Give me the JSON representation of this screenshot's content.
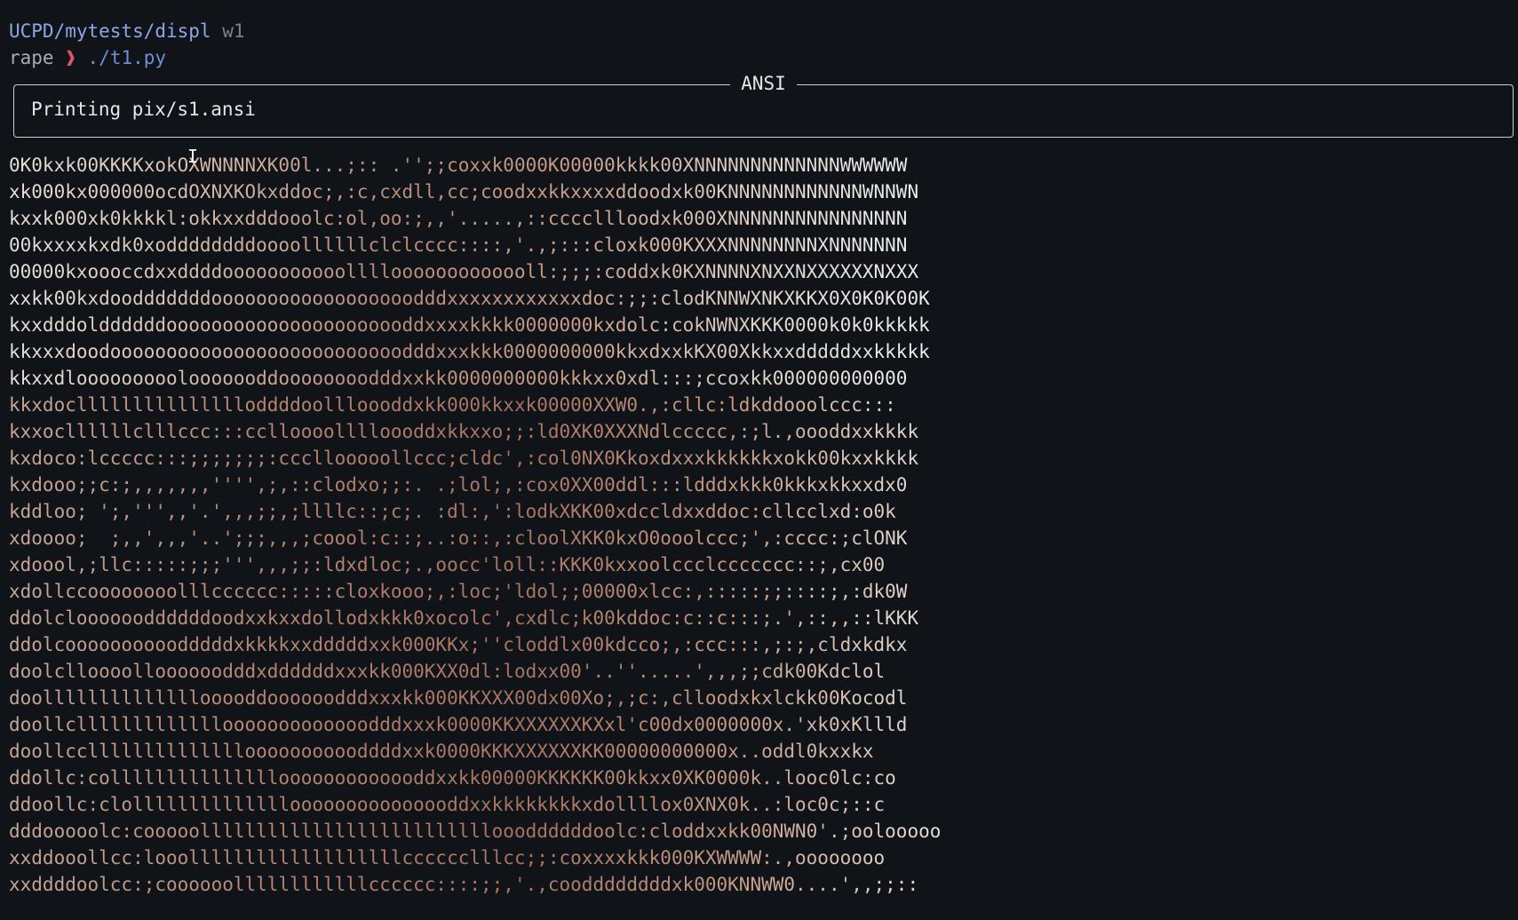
{
  "terminal": {
    "prompt": {
      "path": "UCPD/mytests/displ",
      "host": "w1",
      "cwd_tail": "rape",
      "arrow": "❱",
      "command": "./t1.py"
    },
    "panel": {
      "title": "ANSI",
      "message": "Printing pix/s1.ansi"
    },
    "art_lines": [
      "0K0kxk00KKKKxokOXWNNNNXK00l...;:: .'';;coxxk0000K00000kkkk00XNNNNNNNNNNNNNWWWWWW",
      "xk000kx000000ocdOXNXKOkxddoc;,:c,cxdll,cc;coodxxkkxxxxddoodxk00KNNNNNNNNNNNNWNNWN",
      "kxxk000xk0kkkkl:okkxxdddooolc:ol,oo:;,,'.....,::ccccllloodxk000XNNNNNNNNNNNNNNNN",
      "00kxxxxkxdk0xoddddddddoooollllllclclcccc::::,'.,;:::cloxk000KXXXNNNNNNNNXNNNNNNN",
      "00000kxoooccdxxddddooooooooooollllooooooooooooll:;;;:coddxk0KXNNNNXNXXNXXXXXXNXXX",
      "xxkk00kxdoodddddddoooooooooooooooooodddxxxxxxxxxxxxdoc:;;:clodKNNWXNKXKKX0X0K0K00K",
      "kxxdddolddddddoooooooooooooooooooooddxxxxkkkk0000000kxdolc:cokNWNXKKK0000k0k0kkkkk",
      "kkxxxdoodoooooooooooooooooooooooooodddxxxkkk0000000000kkxdxxkKX00Xkkxxdddddxxkkkkk",
      "kkxxdlooooooooolooooooddoooooooodddxxkk0000000000kkkxx0xdl:::;ccoxkk000000000000",
      "kkxdocllllllllllllllloddddoollloooddxkk000kkxxk00000XXW0.,:cllc:ldkddooolccc:::",
      "kxxocllllllclllccc:::cclloooolllloooddxkkxxo;;:ld0XK0XXXNdlccccc,:;l.,oooddxxkkkk",
      "kxdoco:lccccc:::;;;;;;;:cccllooooollccc;cldc',:col0NX0Kkoxdxxxkkkkkkxokk00kxxkkkk",
      "kxdooo;;c:;,,,,,,,'''',;,::clodxo;;:. .;lol;,:cox0XX00ddl:::ldddxkkk0kkkxkkxxdx0",
      "kddloo; ';,''',,'.',,,;;,;llllc::;c;. :dl:,':lodkXKK00xdccldxxddoc:cllcclxd:o0k",
      "xdoooo;  ;,,',,,'..';;;,,,;coool:c::;..:o::,:cloolXKK0kxO0ooolccc;',:cccc:;clONK",
      "xdoool,;llc:::::;;;''',,,;;:ldxdloc;.,oocc'loll::KKK0kxxoolccclccccccc::;,cx00",
      "xdollccoooooooolllcccccc:::::cloxkooo;,:loc;'ldol;;00000xlcc:,:::::;;::::;,:dk0W",
      "ddolclooooooddddddoodxxkxxdollodxkkk0xocolc',cxdlc;k00kddoc:c::c:::;.',::,,::lKKK",
      "ddolcoooooooooodddddxkkkkxxdddddxxk000KKx;''cloddlx00kdcco;,:ccc:::,;:;,cldxkdkx",
      "doolclloooolloooooodddxddddddxxxkk000KXX0dl:lodxx00'..''.....',,,;;cdk00Kdclol",
      "doollllllllllllllooooddoooooodddxxxkk000KKXXX00dx00Xo;,;c:,clloodxkxlckk00Kocodl",
      "doollclllllllllllllooooooooooooodddxxxk0000KKXXXXXXKXxl'c00dx0000000x.'xk0xKllld",
      "doollccllllllllllllllooooooooooddddxxk0000KKKXXXXXXKK00000000000x..oddl0kxxkx",
      "ddollc:colllllllllllllllooooooooooooddxxkk00000KKKKKK00kkxx0XK0000k..looc0lc:co",
      "ddoollc:clollllllllllllllooooooooooooooddxxkkkkkkkkxdollllox0XNX0k..:loc0c;::c",
      "dddooooolc:cooooolllllllllllllllllllllllllloooddddddoolc:cloddxxkk00NWN0'.;oolooooo",
      "xxddooollcc:looolllllllllllllllllllcccccclllcc;;:coxxxxkkk000KXWWWW:.,oooooooo",
      "xxddddoolcc:;coooooollllllllllllcccccc::::;;,'.,cooddddddddxk000KNNWW0....',,;;::"
    ]
  }
}
